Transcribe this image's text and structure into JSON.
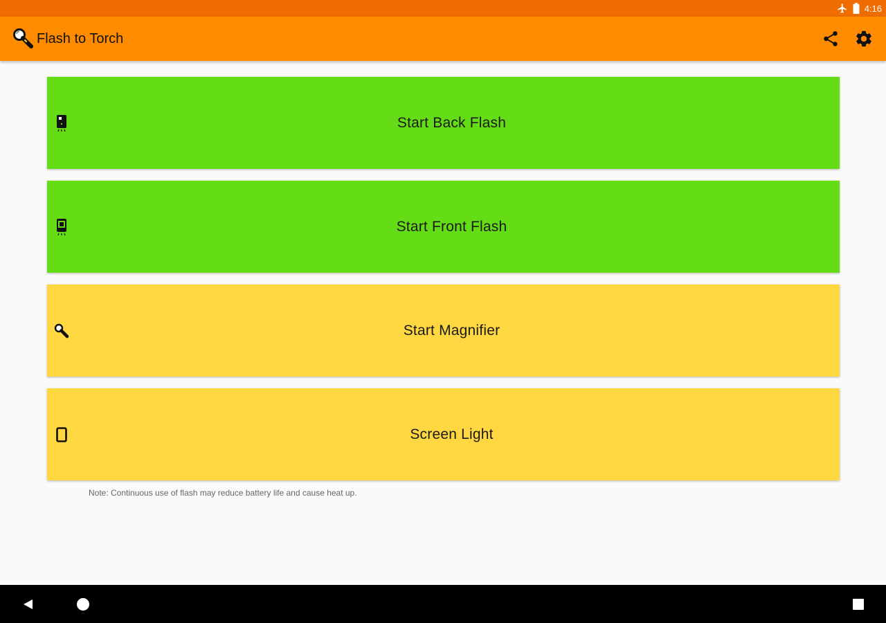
{
  "status_bar": {
    "time": "4:16",
    "icons": [
      "airplane-icon",
      "battery-icon"
    ],
    "background": "#ef6c00"
  },
  "app_bar": {
    "title": "Flash to Torch",
    "logo_icon": "flashlight-icon",
    "actions": [
      {
        "name": "share-button",
        "icon": "share-icon"
      },
      {
        "name": "settings-button",
        "icon": "gear-icon"
      }
    ],
    "background": "#ff8c00"
  },
  "buttons": [
    {
      "label": "Start Back Flash",
      "icon": "phone-back-flash-icon",
      "color": "#64dd17"
    },
    {
      "label": "Start Front Flash",
      "icon": "phone-front-flash-icon",
      "color": "#64dd17"
    },
    {
      "label": "Start Magnifier",
      "icon": "magnifier-icon",
      "color": "#ffd740"
    },
    {
      "label": "Screen Light",
      "icon": "phone-outline-icon",
      "color": "#ffd740"
    }
  ],
  "note": "Note: Continuous use of flash may reduce battery life and cause heat up.",
  "nav_bar": {
    "buttons": [
      "back-icon",
      "home-icon",
      "recents-icon"
    ]
  }
}
